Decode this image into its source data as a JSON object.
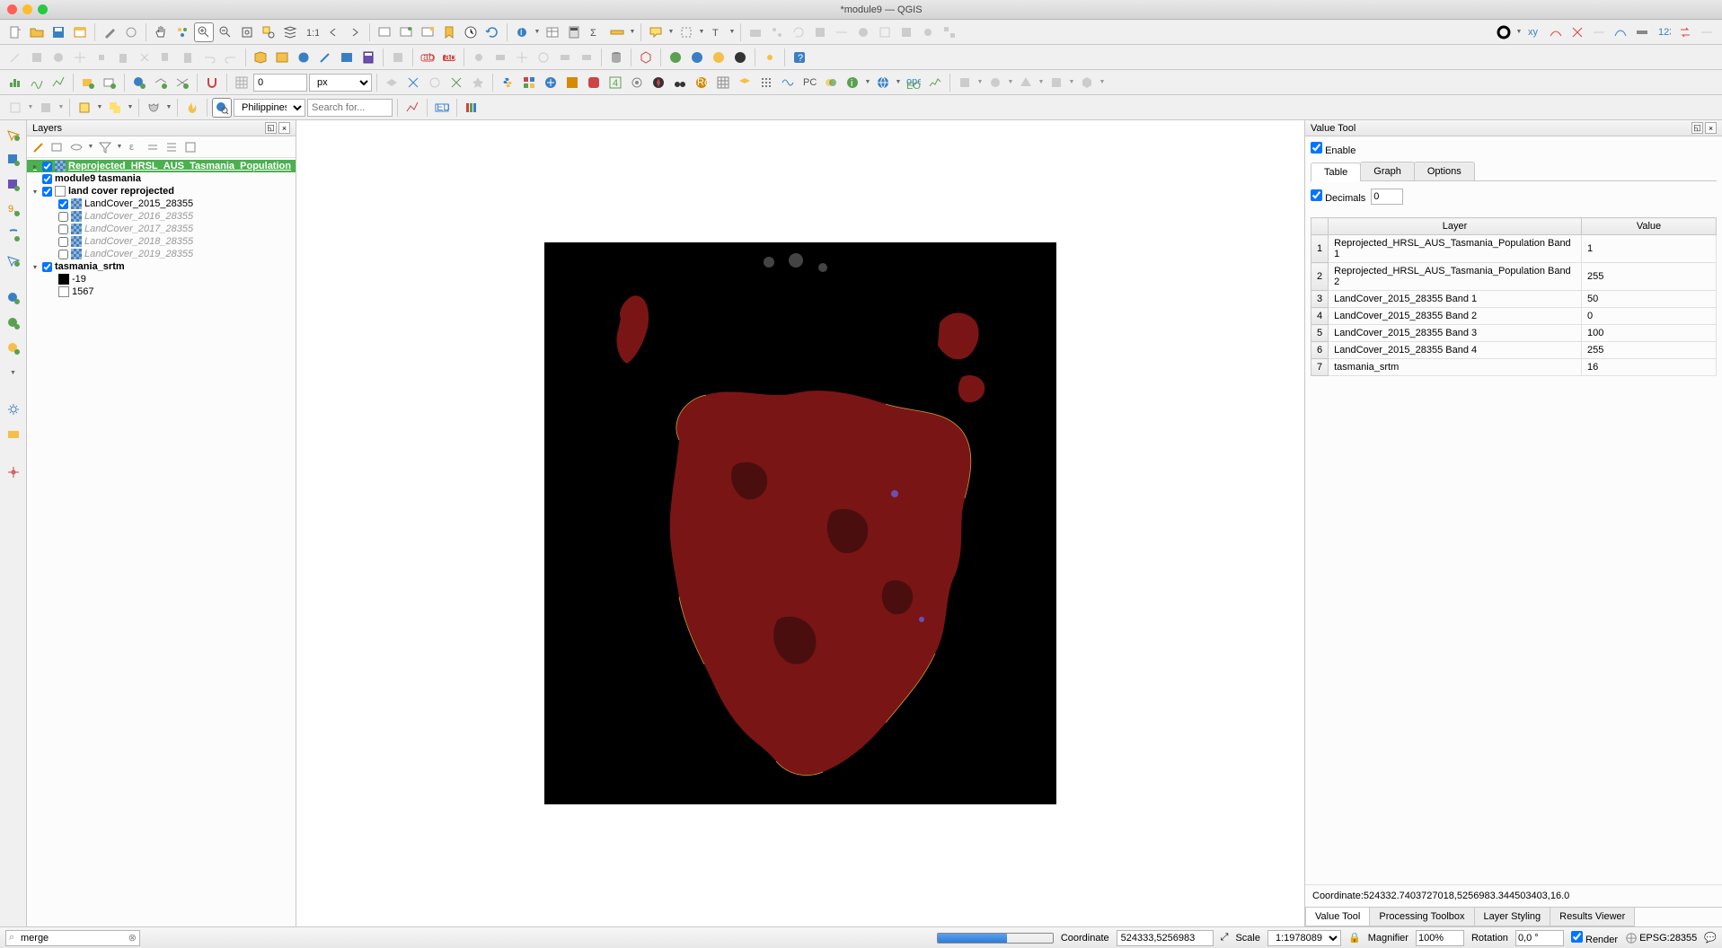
{
  "window": {
    "title": "*module9 — QGIS"
  },
  "toolbar3": {
    "number_value": "0",
    "unit": "px"
  },
  "toolbar4": {
    "region": "Philippines",
    "search_placeholder": "Search for..."
  },
  "layers_panel": {
    "title": "Layers",
    "items": [
      {
        "name": "Reprojected_HRSL_AUS_Tasmania_Population",
        "checked": true,
        "selected": true,
        "type": "raster",
        "indent": 0,
        "expand": "▸"
      },
      {
        "name": "module9 tasmania",
        "checked": true,
        "type": "bold",
        "indent": 0
      },
      {
        "name": "land cover reprojected",
        "checked": true,
        "type": "group",
        "indent": 0,
        "expand": "▾"
      },
      {
        "name": "LandCover_2015_28355",
        "checked": true,
        "type": "raster",
        "indent": 1
      },
      {
        "name": "LandCover_2016_28355",
        "checked": false,
        "type": "raster",
        "indent": 1,
        "muted": true
      },
      {
        "name": "LandCover_2017_28355",
        "checked": false,
        "type": "raster",
        "indent": 1,
        "muted": true
      },
      {
        "name": "LandCover_2018_28355",
        "checked": false,
        "type": "raster",
        "indent": 1,
        "muted": true
      },
      {
        "name": "LandCover_2019_28355",
        "checked": false,
        "type": "raster",
        "indent": 1,
        "muted": true
      },
      {
        "name": "tasmania_srtm",
        "checked": true,
        "type": "bold",
        "indent": 0,
        "expand": "▾"
      },
      {
        "name": "-19",
        "type": "legend-black",
        "indent": 1
      },
      {
        "name": "1567",
        "type": "legend-white",
        "indent": 1
      }
    ]
  },
  "value_tool": {
    "title": "Value Tool",
    "enable_label": "Enable",
    "tabs": [
      "Table",
      "Graph",
      "Options"
    ],
    "active_tab": "Table",
    "decimals_label": "Decimals",
    "decimals_value": "0",
    "columns": [
      "Layer",
      "Value"
    ],
    "rows": [
      {
        "n": "1",
        "layer": "Reprojected_HRSL_AUS_Tasmania_Population Band 1",
        "value": "1"
      },
      {
        "n": "2",
        "layer": "Reprojected_HRSL_AUS_Tasmania_Population Band 2",
        "value": "255"
      },
      {
        "n": "3",
        "layer": "LandCover_2015_28355 Band 1",
        "value": "50"
      },
      {
        "n": "4",
        "layer": "LandCover_2015_28355 Band 2",
        "value": "0"
      },
      {
        "n": "5",
        "layer": "LandCover_2015_28355 Band 3",
        "value": "100"
      },
      {
        "n": "6",
        "layer": "LandCover_2015_28355 Band 4",
        "value": "255"
      },
      {
        "n": "7",
        "layer": "tasmania_srtm",
        "value": "16"
      }
    ],
    "coordinate_line": "Coordinate:524332.7403727018,5256983.344503403,16.0",
    "bottom_tabs": [
      "Value Tool",
      "Processing Toolbox",
      "Layer Styling",
      "Results Viewer"
    ]
  },
  "status": {
    "search_value": "merge",
    "coord_label": "Coordinate",
    "coord_value": "524333,5256983",
    "scale_label": "Scale",
    "scale_value": "1:1978089",
    "mag_label": "Magnifier",
    "mag_value": "100%",
    "rot_label": "Rotation",
    "rot_value": "0,0 °",
    "render_label": "Render",
    "crs": "EPSG:28355"
  }
}
